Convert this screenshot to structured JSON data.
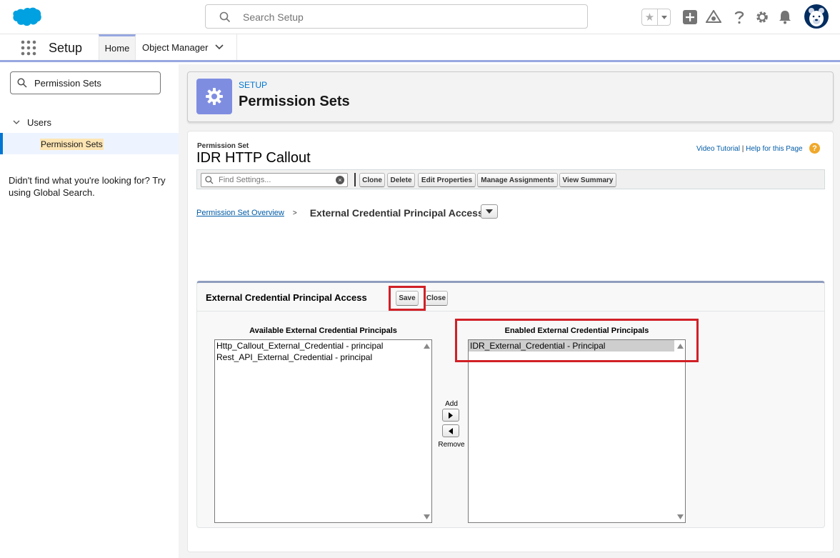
{
  "global_search": {
    "placeholder": "Search Setup"
  },
  "nav": {
    "app_name": "Setup",
    "tabs": [
      {
        "label": "Home"
      },
      {
        "label": "Object Manager"
      }
    ]
  },
  "sidebar": {
    "quick_find_value": "Permission Sets",
    "tree_parent": "Users",
    "tree_child": "Permission Sets",
    "not_found_text": "Didn't find what you're looking for? Try using Global Search."
  },
  "header": {
    "breadcrumb": "SETUP",
    "title": "Permission Sets"
  },
  "permission_set": {
    "label": "Permission Set",
    "name": "IDR HTTP Callout",
    "video_tutorial": "Video Tutorial",
    "help_separator": " | ",
    "help_link": "Help for this Page",
    "help_icon": "?"
  },
  "toolbar": {
    "find_placeholder": "Find Settings...",
    "clear_icon": "×",
    "buttons": [
      "Clone",
      "Delete",
      "Edit Properties",
      "Manage Assignments",
      "View Summary"
    ]
  },
  "breadcrumb": {
    "overview_link": "Permission Set Overview",
    "separator": ">",
    "current": "External Credential Principal Access"
  },
  "panel": {
    "title": "External Credential Principal Access",
    "save_label": "Save",
    "close_label": "Close",
    "available_label": "Available External Credential Principals",
    "enabled_label": "Enabled External Credential Principals",
    "available_items": [
      "Http_Callout_External_Credential - principal",
      "Rest_API_External_Credential - principal"
    ],
    "enabled_items": [
      "IDR_External_Credential - Principal"
    ],
    "add_label": "Add",
    "remove_label": "Remove"
  },
  "colors": {
    "brand_blue": "#0176d3",
    "highlight_red": "#d12027",
    "setup_icon_bg": "#7f8de1"
  }
}
